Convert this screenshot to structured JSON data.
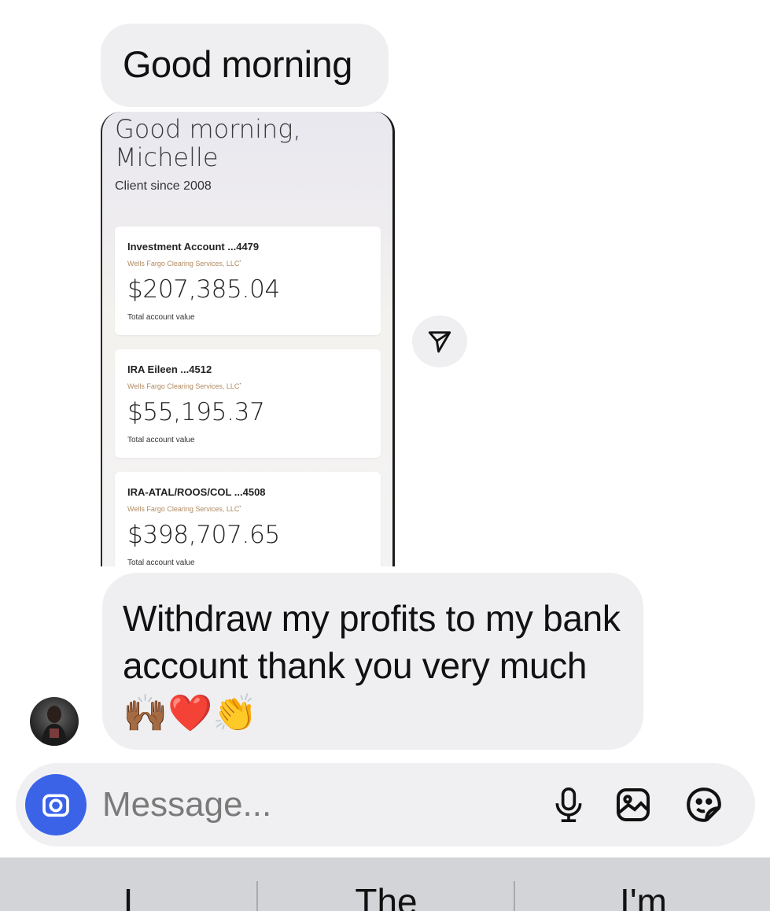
{
  "messages": {
    "first": "Good morning",
    "reply": "Withdraw my profits to my bank account thank you very much 🙌🏾❤️👏"
  },
  "screenshot": {
    "greeting": "Good morning,\nMichelle",
    "client_since": "Client since 2008",
    "accounts": [
      {
        "name": "Investment Account ...4479",
        "firm": "Wells Fargo Clearing Services, LLC",
        "amount": "$207,385.04",
        "label": "Total account value"
      },
      {
        "name": "IRA Eileen ...4512",
        "firm": "Wells Fargo Clearing Services, LLC",
        "amount": "$55,195.37",
        "label": "Total account value"
      },
      {
        "name": "IRA-ATAL/ROOS/COL ...4508",
        "firm": "Wells Fargo Clearing Services, LLC",
        "amount": "$398,707.65",
        "label": "Total account value"
      }
    ]
  },
  "composer": {
    "placeholder": "Message..."
  },
  "keyboard": {
    "suggestions": [
      "I",
      "The",
      "I'm"
    ]
  },
  "icons": {
    "share": "paper-plane-icon",
    "camera": "camera-icon",
    "mic": "microphone-icon",
    "gallery": "image-icon",
    "sticker": "sticker-icon"
  },
  "colors": {
    "bubble": "#efeff1",
    "camera_button": "#3a63e8",
    "firm_text": "#b08a5f",
    "keyboard_bar": "#d3d4d8"
  }
}
